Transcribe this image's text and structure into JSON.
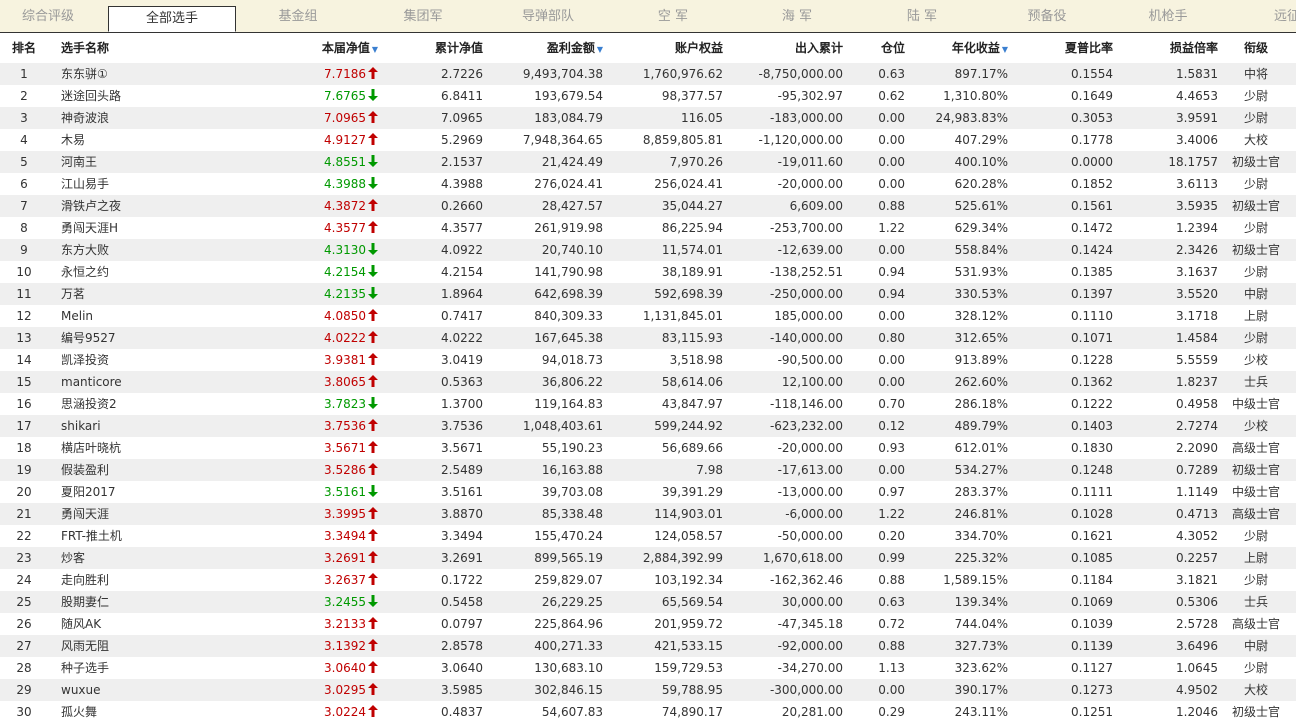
{
  "tabs": [
    "综合评级",
    "全部选手",
    "基金组",
    "集团军",
    "导弹部队",
    "空 军",
    "海 军",
    "陆 军",
    "预备役",
    "机枪手",
    "远征"
  ],
  "active_tab": 1,
  "headers": [
    "排名",
    "选手名称",
    "本届净值",
    "累计净值",
    "盈利金额",
    "账户权益",
    "出入累计",
    "仓位",
    "年化收益",
    "夏普比率",
    "损益倍率",
    "衔级"
  ],
  "sort_marker": "▼",
  "colors": {
    "up": "#c00000",
    "down": "#009900"
  },
  "rows": [
    {
      "rank": "1",
      "name": "东东骈①",
      "nav": "7.7186",
      "dir": "up",
      "cum": "2.7226",
      "profit": "9,493,704.38",
      "equity": "1,760,976.62",
      "flow": "-8,750,000.00",
      "pos": "0.63",
      "annual": "897.17%",
      "sharpe": "0.1554",
      "ratio": "1.5831",
      "grade": "中将"
    },
    {
      "rank": "2",
      "name": "迷途回头路",
      "nav": "7.6765",
      "dir": "down",
      "cum": "6.8411",
      "profit": "193,679.54",
      "equity": "98,377.57",
      "flow": "-95,302.97",
      "pos": "0.62",
      "annual": "1,310.80%",
      "sharpe": "0.1649",
      "ratio": "4.4653",
      "grade": "少尉"
    },
    {
      "rank": "3",
      "name": "神奇波浪",
      "nav": "7.0965",
      "dir": "up",
      "cum": "7.0965",
      "profit": "183,084.79",
      "equity": "116.05",
      "flow": "-183,000.00",
      "pos": "0.00",
      "annual": "24,983.83%",
      "sharpe": "0.3053",
      "ratio": "3.9591",
      "grade": "少尉"
    },
    {
      "rank": "4",
      "name": "木易",
      "nav": "4.9127",
      "dir": "up",
      "cum": "5.2969",
      "profit": "7,948,364.65",
      "equity": "8,859,805.81",
      "flow": "-1,120,000.00",
      "pos": "0.00",
      "annual": "407.29%",
      "sharpe": "0.1778",
      "ratio": "3.4006",
      "grade": "大校"
    },
    {
      "rank": "5",
      "name": "河南王",
      "nav": "4.8551",
      "dir": "down",
      "cum": "2.1537",
      "profit": "21,424.49",
      "equity": "7,970.26",
      "flow": "-19,011.60",
      "pos": "0.00",
      "annual": "400.10%",
      "sharpe": "0.0000",
      "ratio": "18.1757",
      "grade": "初级士官"
    },
    {
      "rank": "6",
      "name": "江山易手",
      "nav": "4.3988",
      "dir": "down",
      "cum": "4.3988",
      "profit": "276,024.41",
      "equity": "256,024.41",
      "flow": "-20,000.00",
      "pos": "0.00",
      "annual": "620.28%",
      "sharpe": "0.1852",
      "ratio": "3.6113",
      "grade": "少尉"
    },
    {
      "rank": "7",
      "name": "滑铁卢之夜",
      "nav": "4.3872",
      "dir": "up",
      "cum": "0.2660",
      "profit": "28,427.57",
      "equity": "35,044.27",
      "flow": "6,609.00",
      "pos": "0.88",
      "annual": "525.61%",
      "sharpe": "0.1561",
      "ratio": "3.5935",
      "grade": "初级士官"
    },
    {
      "rank": "8",
      "name": "勇闯天涯H",
      "nav": "4.3577",
      "dir": "up",
      "cum": "4.3577",
      "profit": "261,919.98",
      "equity": "86,225.94",
      "flow": "-253,700.00",
      "pos": "1.22",
      "annual": "629.34%",
      "sharpe": "0.1472",
      "ratio": "1.2394",
      "grade": "少尉"
    },
    {
      "rank": "9",
      "name": "东方大败",
      "nav": "4.3130",
      "dir": "down",
      "cum": "4.0922",
      "profit": "20,740.10",
      "equity": "11,574.01",
      "flow": "-12,639.00",
      "pos": "0.00",
      "annual": "558.84%",
      "sharpe": "0.1424",
      "ratio": "2.3426",
      "grade": "初级士官"
    },
    {
      "rank": "10",
      "name": "永恒之约",
      "nav": "4.2154",
      "dir": "down",
      "cum": "4.2154",
      "profit": "141,790.98",
      "equity": "38,189.91",
      "flow": "-138,252.51",
      "pos": "0.94",
      "annual": "531.93%",
      "sharpe": "0.1385",
      "ratio": "3.1637",
      "grade": "少尉"
    },
    {
      "rank": "11",
      "name": "万茗",
      "nav": "4.2135",
      "dir": "down",
      "cum": "1.8964",
      "profit": "642,698.39",
      "equity": "592,698.39",
      "flow": "-250,000.00",
      "pos": "0.94",
      "annual": "330.53%",
      "sharpe": "0.1397",
      "ratio": "3.5520",
      "grade": "中尉"
    },
    {
      "rank": "12",
      "name": "Melin",
      "nav": "4.0850",
      "dir": "up",
      "cum": "0.7417",
      "profit": "840,309.33",
      "equity": "1,131,845.01",
      "flow": "185,000.00",
      "pos": "0.00",
      "annual": "328.12%",
      "sharpe": "0.1110",
      "ratio": "3.1718",
      "grade": "上尉"
    },
    {
      "rank": "13",
      "name": "编号9527",
      "nav": "4.0222",
      "dir": "up",
      "cum": "4.0222",
      "profit": "167,645.38",
      "equity": "83,115.93",
      "flow": "-140,000.00",
      "pos": "0.80",
      "annual": "312.65%",
      "sharpe": "0.1071",
      "ratio": "1.4584",
      "grade": "少尉"
    },
    {
      "rank": "14",
      "name": "凯泽投资",
      "nav": "3.9381",
      "dir": "up",
      "cum": "3.0419",
      "profit": "94,018.73",
      "equity": "3,518.98",
      "flow": "-90,500.00",
      "pos": "0.00",
      "annual": "913.89%",
      "sharpe": "0.1228",
      "ratio": "5.5559",
      "grade": "少校"
    },
    {
      "rank": "15",
      "name": "manticore",
      "nav": "3.8065",
      "dir": "up",
      "cum": "0.5363",
      "profit": "36,806.22",
      "equity": "58,614.06",
      "flow": "12,100.00",
      "pos": "0.00",
      "annual": "262.60%",
      "sharpe": "0.1362",
      "ratio": "1.8237",
      "grade": "士兵"
    },
    {
      "rank": "16",
      "name": "思涵投资2",
      "nav": "3.7823",
      "dir": "down",
      "cum": "1.3700",
      "profit": "119,164.83",
      "equity": "43,847.97",
      "flow": "-118,146.00",
      "pos": "0.70",
      "annual": "286.18%",
      "sharpe": "0.1222",
      "ratio": "0.4958",
      "grade": "中级士官"
    },
    {
      "rank": "17",
      "name": "shikari",
      "nav": "3.7536",
      "dir": "up",
      "cum": "3.7536",
      "profit": "1,048,403.61",
      "equity": "599,244.92",
      "flow": "-623,232.00",
      "pos": "0.12",
      "annual": "489.79%",
      "sharpe": "0.1403",
      "ratio": "2.7274",
      "grade": "少校"
    },
    {
      "rank": "18",
      "name": "横店叶晓杭",
      "nav": "3.5671",
      "dir": "up",
      "cum": "3.5671",
      "profit": "55,190.23",
      "equity": "56,689.66",
      "flow": "-20,000.00",
      "pos": "0.93",
      "annual": "612.01%",
      "sharpe": "0.1830",
      "ratio": "2.2090",
      "grade": "高级士官"
    },
    {
      "rank": "19",
      "name": "假装盈利",
      "nav": "3.5286",
      "dir": "up",
      "cum": "2.5489",
      "profit": "16,163.88",
      "equity": "7.98",
      "flow": "-17,613.00",
      "pos": "0.00",
      "annual": "534.27%",
      "sharpe": "0.1248",
      "ratio": "0.7289",
      "grade": "初级士官"
    },
    {
      "rank": "20",
      "name": "夏阳2017",
      "nav": "3.5161",
      "dir": "down",
      "cum": "3.5161",
      "profit": "39,703.08",
      "equity": "39,391.29",
      "flow": "-13,000.00",
      "pos": "0.97",
      "annual": "283.37%",
      "sharpe": "0.1111",
      "ratio": "1.1149",
      "grade": "中级士官"
    },
    {
      "rank": "21",
      "name": "勇闯天涯",
      "nav": "3.3995",
      "dir": "up",
      "cum": "3.8870",
      "profit": "85,338.48",
      "equity": "114,903.01",
      "flow": "-6,000.00",
      "pos": "1.22",
      "annual": "246.81%",
      "sharpe": "0.1028",
      "ratio": "0.4713",
      "grade": "高级士官"
    },
    {
      "rank": "22",
      "name": "FRT-推土机",
      "nav": "3.3494",
      "dir": "up",
      "cum": "3.3494",
      "profit": "155,470.24",
      "equity": "124,058.57",
      "flow": "-50,000.00",
      "pos": "0.20",
      "annual": "334.70%",
      "sharpe": "0.1621",
      "ratio": "4.3052",
      "grade": "少尉"
    },
    {
      "rank": "23",
      "name": "炒客",
      "nav": "3.2691",
      "dir": "up",
      "cum": "3.2691",
      "profit": "899,565.19",
      "equity": "2,884,392.99",
      "flow": "1,670,618.00",
      "pos": "0.99",
      "annual": "225.32%",
      "sharpe": "0.1085",
      "ratio": "0.2257",
      "grade": "上尉"
    },
    {
      "rank": "24",
      "name": "走向胜利",
      "nav": "3.2637",
      "dir": "up",
      "cum": "0.1722",
      "profit": "259,829.07",
      "equity": "103,192.34",
      "flow": "-162,362.46",
      "pos": "0.88",
      "annual": "1,589.15%",
      "sharpe": "0.1184",
      "ratio": "3.1821",
      "grade": "少尉"
    },
    {
      "rank": "25",
      "name": "股期妻仁",
      "nav": "3.2455",
      "dir": "down",
      "cum": "0.5458",
      "profit": "26,229.25",
      "equity": "65,569.54",
      "flow": "30,000.00",
      "pos": "0.63",
      "annual": "139.34%",
      "sharpe": "0.1069",
      "ratio": "0.5306",
      "grade": "士兵"
    },
    {
      "rank": "26",
      "name": "随风AK",
      "nav": "3.2133",
      "dir": "up",
      "cum": "0.0797",
      "profit": "225,864.96",
      "equity": "201,959.72",
      "flow": "-47,345.18",
      "pos": "0.72",
      "annual": "744.04%",
      "sharpe": "0.1039",
      "ratio": "2.5728",
      "grade": "高级士官"
    },
    {
      "rank": "27",
      "name": "风雨无阻",
      "nav": "3.1392",
      "dir": "up",
      "cum": "2.8578",
      "profit": "400,271.33",
      "equity": "421,533.15",
      "flow": "-92,000.00",
      "pos": "0.88",
      "annual": "327.73%",
      "sharpe": "0.1139",
      "ratio": "3.6496",
      "grade": "中尉"
    },
    {
      "rank": "28",
      "name": "种子选手",
      "nav": "3.0640",
      "dir": "up",
      "cum": "3.0640",
      "profit": "130,683.10",
      "equity": "159,729.53",
      "flow": "-34,270.00",
      "pos": "1.13",
      "annual": "323.62%",
      "sharpe": "0.1127",
      "ratio": "1.0645",
      "grade": "少尉"
    },
    {
      "rank": "29",
      "name": "wuxue",
      "nav": "3.0295",
      "dir": "up",
      "cum": "3.5985",
      "profit": "302,846.15",
      "equity": "59,788.95",
      "flow": "-300,000.00",
      "pos": "0.00",
      "annual": "390.17%",
      "sharpe": "0.1273",
      "ratio": "4.9502",
      "grade": "大校"
    },
    {
      "rank": "30",
      "name": "孤火舞",
      "nav": "3.0224",
      "dir": "up",
      "cum": "0.4837",
      "profit": "54,607.83",
      "equity": "74,890.17",
      "flow": "20,281.00",
      "pos": "0.29",
      "annual": "243.11%",
      "sharpe": "0.1251",
      "ratio": "1.2046",
      "grade": "初级士官"
    }
  ]
}
